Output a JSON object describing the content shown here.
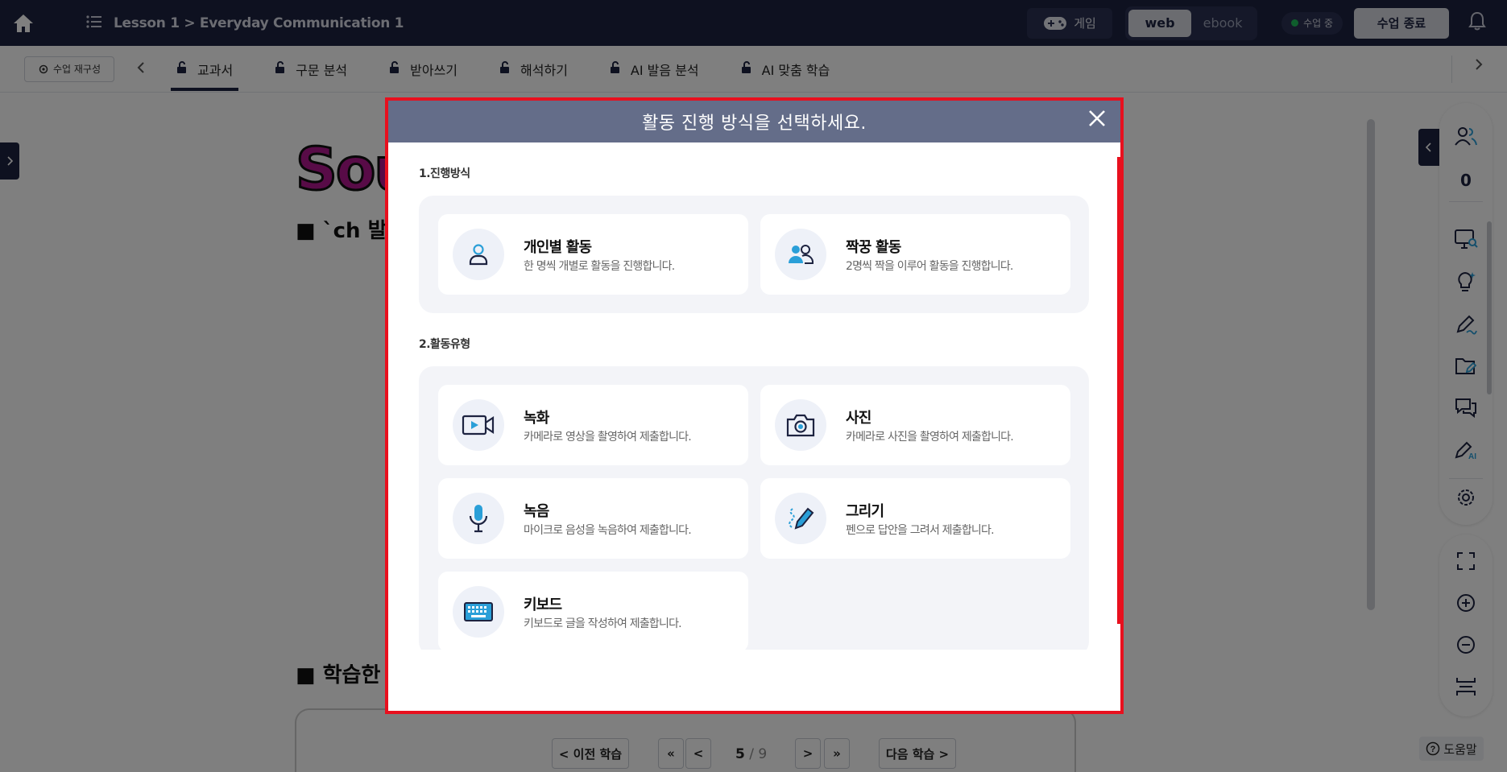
{
  "topbar": {
    "home_icon": "home-icon",
    "menu_icon": "list-icon",
    "lesson_title": "Lesson 1 > Everyday Communication 1",
    "game_label": "게임",
    "mode_web": "web",
    "mode_ebook": "ebook",
    "live_label": "수업 중",
    "end_label": "수업 종료",
    "bell_icon": "bell-icon"
  },
  "tabbar": {
    "reconfigure_label": "수업 재구성",
    "tabs": [
      {
        "label": "교과서"
      },
      {
        "label": "구문 분석"
      },
      {
        "label": "받아쓰기"
      },
      {
        "label": "해석하기"
      },
      {
        "label": "AI 발음 분석"
      },
      {
        "label": "AI 맞춤 학습"
      }
    ]
  },
  "background": {
    "title_partial": "Sou",
    "subtitle_partial": "■ `ch 발",
    "section_partial": "■ 학습한"
  },
  "right_panel": {
    "participant_count": "0"
  },
  "bottom_nav": {
    "prev_label": "< 이전 학습",
    "first_label": "«",
    "back_label": "<",
    "current_page": "5",
    "total_pages": "/ 9",
    "forward_label": ">",
    "last_label": "»",
    "next_label": "다음 학습 >",
    "help_label": "도움말"
  },
  "modal": {
    "title": "활동 진행 방식을 선택하세요.",
    "close_icon": "close-icon",
    "section1_label": "1.진행방식",
    "section2_label": "2.활동유형",
    "modes": [
      {
        "title": "개인별 활동",
        "desc": "한 명씩 개별로 활동을 진행합니다.",
        "icon": "person-icon"
      },
      {
        "title": "짝꿍 활동",
        "desc": "2명씩 짝을 이루어 활동을 진행합니다.",
        "icon": "pair-icon"
      }
    ],
    "types": [
      {
        "title": "녹화",
        "desc": "카메라로 영상을 촬영하여 제출합니다.",
        "icon": "video-camera-icon"
      },
      {
        "title": "사진",
        "desc": "카메라로 사진을 촬영하여 제출합니다.",
        "icon": "camera-icon"
      },
      {
        "title": "녹음",
        "desc": "마이크로 음성을 녹음하여 제출합니다.",
        "icon": "microphone-icon"
      },
      {
        "title": "그리기",
        "desc": "펜으로 답안을 그려서 제출합니다.",
        "icon": "pen-icon"
      },
      {
        "title": "키보드",
        "desc": "키보드로 글을 작성하여 제출합니다.",
        "icon": "keyboard-icon"
      }
    ]
  },
  "colors": {
    "nav_dark": "#1d2340",
    "modal_header": "#646d89",
    "highlight_border": "#e8101e",
    "icon_blue": "#2a9fd8"
  }
}
